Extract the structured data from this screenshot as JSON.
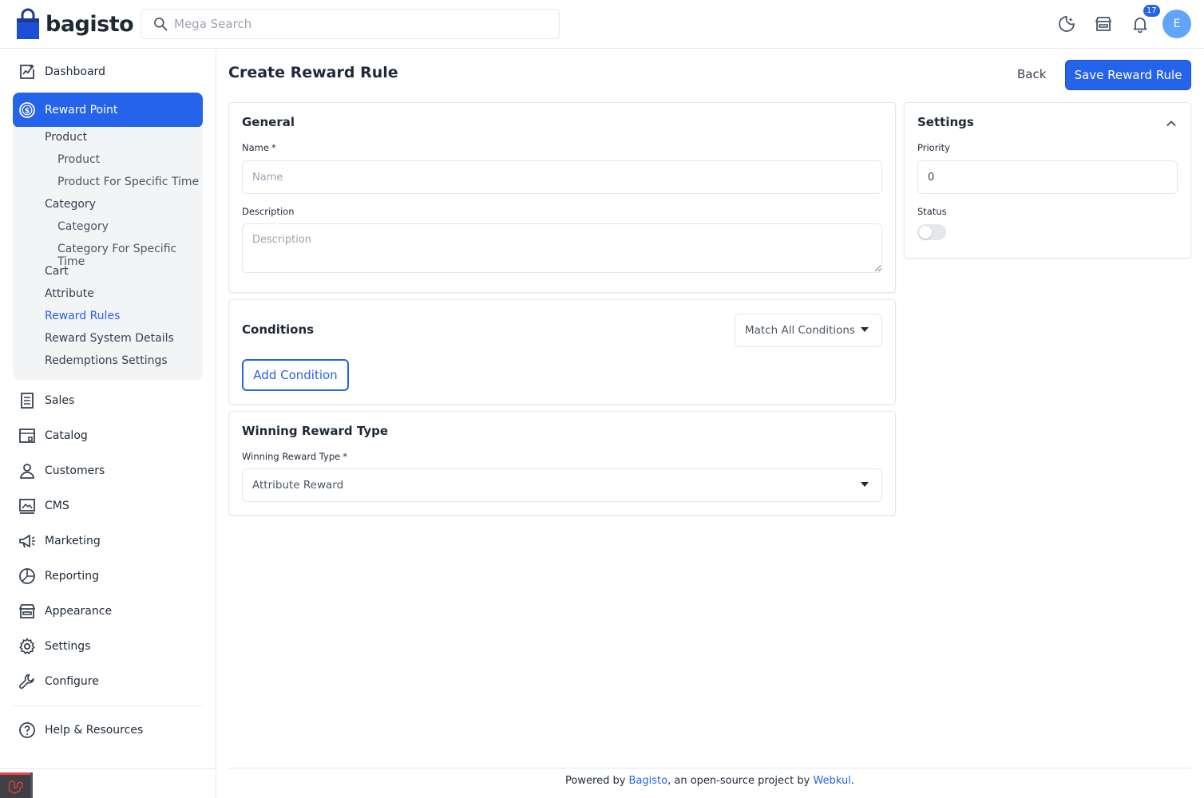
{
  "app": {
    "name": "bagisto",
    "brand_color": "#2563eb"
  },
  "header": {
    "search_placeholder": "Mega Search",
    "notification_count": "17",
    "avatar_initial": "E"
  },
  "sidebar": {
    "items": [
      {
        "label": "Dashboard",
        "icon": "dashboard-icon"
      },
      {
        "label": "Reward Point",
        "icon": "dollar-circle-icon",
        "active": true
      },
      {
        "label": "Sales",
        "icon": "receipt-icon"
      },
      {
        "label": "Catalog",
        "icon": "catalog-icon"
      },
      {
        "label": "Customers",
        "icon": "person-icon"
      },
      {
        "label": "CMS",
        "icon": "cms-icon"
      },
      {
        "label": "Marketing",
        "icon": "megaphone-icon"
      },
      {
        "label": "Reporting",
        "icon": "pie-chart-icon"
      },
      {
        "label": "Appearance",
        "icon": "store-icon"
      },
      {
        "label": "Settings",
        "icon": "gear-icon"
      },
      {
        "label": "Configure",
        "icon": "wrench-icon"
      }
    ],
    "submenu": [
      {
        "label": "Product",
        "level": 1
      },
      {
        "label": "Product",
        "level": 2
      },
      {
        "label": "Product For Specific Time",
        "level": 2
      },
      {
        "label": "Category",
        "level": 1
      },
      {
        "label": "Category",
        "level": 2
      },
      {
        "label": "Category For Specific Time",
        "level": 2
      },
      {
        "label": "Cart",
        "level": 1
      },
      {
        "label": "Attribute",
        "level": 1
      },
      {
        "label": "Reward Rules",
        "level": 1,
        "current": true
      },
      {
        "label": "Reward System Details",
        "level": 1
      },
      {
        "label": "Redemptions Settings",
        "level": 1
      }
    ],
    "help_label": "Help & Resources"
  },
  "page": {
    "title": "Create Reward Rule",
    "back_label": "Back",
    "save_label": "Save Reward Rule"
  },
  "general": {
    "title": "General",
    "name_label": "Name",
    "name_placeholder": "Name",
    "description_label": "Description",
    "description_placeholder": "Description",
    "required_mark": "*"
  },
  "conditions": {
    "title": "Conditions",
    "match_value": "Match All Conditions",
    "add_label": "Add Condition"
  },
  "winning": {
    "title": "Winning Reward Type",
    "field_label": "Winning Reward Type",
    "value": "Attribute Reward"
  },
  "settings": {
    "title": "Settings",
    "priority_label": "Priority",
    "priority_value": "0",
    "status_label": "Status",
    "status_on": false
  },
  "footer": {
    "prefix": "Powered by ",
    "link1": "Bagisto",
    "middle": ", an open-source project by ",
    "link2": "Webkul",
    "suffix": "."
  }
}
